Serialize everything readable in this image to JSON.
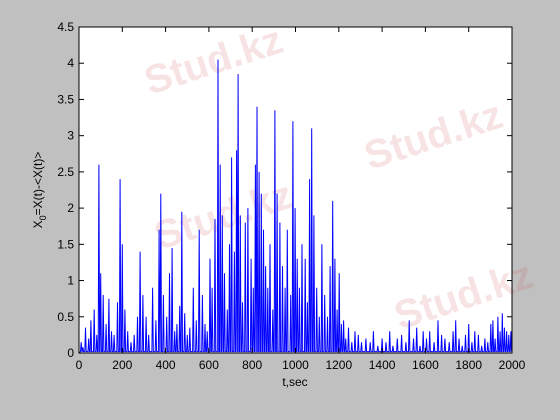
{
  "figure": {
    "background": "#c0c0c0",
    "plot_background": "#ffffff"
  },
  "watermark": "Stud.kz",
  "chart_data": {
    "type": "line",
    "title": "",
    "xlabel": "t,sec",
    "ylabel_parts": {
      "main": "X",
      "sub": "0",
      "rest": "=X(t)-<X(t)>"
    },
    "xlim": [
      0,
      2000
    ],
    "ylim": [
      0,
      4.5
    ],
    "xticks": [
      0,
      200,
      400,
      600,
      800,
      1000,
      1200,
      1400,
      1600,
      1800,
      2000
    ],
    "yticks": [
      0,
      0.5,
      1,
      1.5,
      2,
      2.5,
      3,
      3.5,
      4,
      4.5
    ],
    "grid": false,
    "line_color": "#0000ff",
    "peaks": [
      [
        10,
        0.15
      ],
      [
        18,
        0.08
      ],
      [
        30,
        0.35
      ],
      [
        45,
        0.2
      ],
      [
        55,
        0.45
      ],
      [
        70,
        0.6
      ],
      [
        82,
        0.25
      ],
      [
        92,
        2.6
      ],
      [
        100,
        1.1
      ],
      [
        112,
        0.8
      ],
      [
        125,
        0.4
      ],
      [
        138,
        0.75
      ],
      [
        150,
        0.3
      ],
      [
        162,
        0.25
      ],
      [
        178,
        0.7
      ],
      [
        190,
        2.4
      ],
      [
        200,
        1.5
      ],
      [
        212,
        0.6
      ],
      [
        225,
        0.3
      ],
      [
        240,
        0.15
      ],
      [
        255,
        0.25
      ],
      [
        270,
        0.5
      ],
      [
        282,
        1.4
      ],
      [
        295,
        0.8
      ],
      [
        310,
        0.5
      ],
      [
        322,
        0.25
      ],
      [
        340,
        0.9
      ],
      [
        355,
        0.45
      ],
      [
        370,
        1.7
      ],
      [
        378,
        2.2
      ],
      [
        390,
        0.8
      ],
      [
        405,
        0.5
      ],
      [
        418,
        1.1
      ],
      [
        430,
        1.45
      ],
      [
        442,
        0.3
      ],
      [
        452,
        0.4
      ],
      [
        465,
        0.65
      ],
      [
        475,
        1.95
      ],
      [
        488,
        0.55
      ],
      [
        500,
        0.25
      ],
      [
        512,
        0.35
      ],
      [
        528,
        0.9
      ],
      [
        542,
        0.45
      ],
      [
        555,
        1.7
      ],
      [
        570,
        0.8
      ],
      [
        582,
        0.4
      ],
      [
        592,
        0.3
      ],
      [
        605,
        1.3
      ],
      [
        615,
        0.9
      ],
      [
        628,
        1.85
      ],
      [
        642,
        4.05
      ],
      [
        652,
        2.6
      ],
      [
        662,
        1.9
      ],
      [
        672,
        1.1
      ],
      [
        685,
        0.6
      ],
      [
        695,
        1.5
      ],
      [
        705,
        2.7
      ],
      [
        718,
        1.4
      ],
      [
        728,
        2.8
      ],
      [
        735,
        3.85
      ],
      [
        745,
        1.9
      ],
      [
        755,
        0.7
      ],
      [
        768,
        1.8
      ],
      [
        780,
        2.0
      ],
      [
        795,
        1.3
      ],
      [
        805,
        0.9
      ],
      [
        815,
        2.6
      ],
      [
        822,
        3.4
      ],
      [
        832,
        2.5
      ],
      [
        842,
        2.2
      ],
      [
        852,
        1.7
      ],
      [
        862,
        1.2
      ],
      [
        872,
        0.9
      ],
      [
        882,
        1.5
      ],
      [
        895,
        0.6
      ],
      [
        905,
        3.35
      ],
      [
        915,
        2.2
      ],
      [
        928,
        1.8
      ],
      [
        940,
        1.2
      ],
      [
        952,
        0.9
      ],
      [
        962,
        1.7
      ],
      [
        978,
        0.8
      ],
      [
        988,
        3.2
      ],
      [
        998,
        2.0
      ],
      [
        1008,
        1.3
      ],
      [
        1018,
        0.9
      ],
      [
        1030,
        1.5
      ],
      [
        1045,
        1.3
      ],
      [
        1055,
        0.7
      ],
      [
        1065,
        2.4
      ],
      [
        1075,
        3.1
      ],
      [
        1085,
        1.9
      ],
      [
        1098,
        0.9
      ],
      [
        1110,
        0.5
      ],
      [
        1122,
        1.5
      ],
      [
        1135,
        0.8
      ],
      [
        1148,
        0.5
      ],
      [
        1160,
        1.2
      ],
      [
        1172,
        2.1
      ],
      [
        1182,
        1.3
      ],
      [
        1192,
        0.6
      ],
      [
        1202,
        1.1
      ],
      [
        1212,
        0.4
      ],
      [
        1222,
        0.45
      ],
      [
        1232,
        0.2
      ],
      [
        1245,
        0.35
      ],
      [
        1260,
        0.15
      ],
      [
        1275,
        0.3
      ],
      [
        1290,
        0.25
      ],
      [
        1305,
        0.15
      ],
      [
        1325,
        0.2
      ],
      [
        1345,
        0.15
      ],
      [
        1360,
        0.3
      ],
      [
        1380,
        0.1
      ],
      [
        1400,
        0.2
      ],
      [
        1418,
        0.15
      ],
      [
        1435,
        0.3
      ],
      [
        1450,
        0.1
      ],
      [
        1470,
        0.2
      ],
      [
        1490,
        0.25
      ],
      [
        1510,
        0.15
      ],
      [
        1525,
        0.45
      ],
      [
        1545,
        0.2
      ],
      [
        1560,
        0.35
      ],
      [
        1575,
        0.1
      ],
      [
        1590,
        0.3
      ],
      [
        1605,
        0.2
      ],
      [
        1620,
        0.3
      ],
      [
        1640,
        0.15
      ],
      [
        1658,
        0.45
      ],
      [
        1675,
        0.25
      ],
      [
        1690,
        0.2
      ],
      [
        1710,
        0.15
      ],
      [
        1728,
        0.3
      ],
      [
        1740,
        0.45
      ],
      [
        1755,
        0.2
      ],
      [
        1770,
        0.1
      ],
      [
        1785,
        0.25
      ],
      [
        1800,
        0.4
      ],
      [
        1815,
        0.15
      ],
      [
        1828,
        0.3
      ],
      [
        1845,
        0.25
      ],
      [
        1860,
        0.1
      ],
      [
        1875,
        0.2
      ],
      [
        1888,
        0.15
      ],
      [
        1902,
        0.4
      ],
      [
        1912,
        0.45
      ],
      [
        1922,
        0.2
      ],
      [
        1935,
        0.5
      ],
      [
        1945,
        0.3
      ],
      [
        1955,
        0.55
      ],
      [
        1965,
        0.35
      ],
      [
        1975,
        0.3
      ],
      [
        1985,
        0.25
      ],
      [
        1995,
        0.3
      ]
    ]
  }
}
